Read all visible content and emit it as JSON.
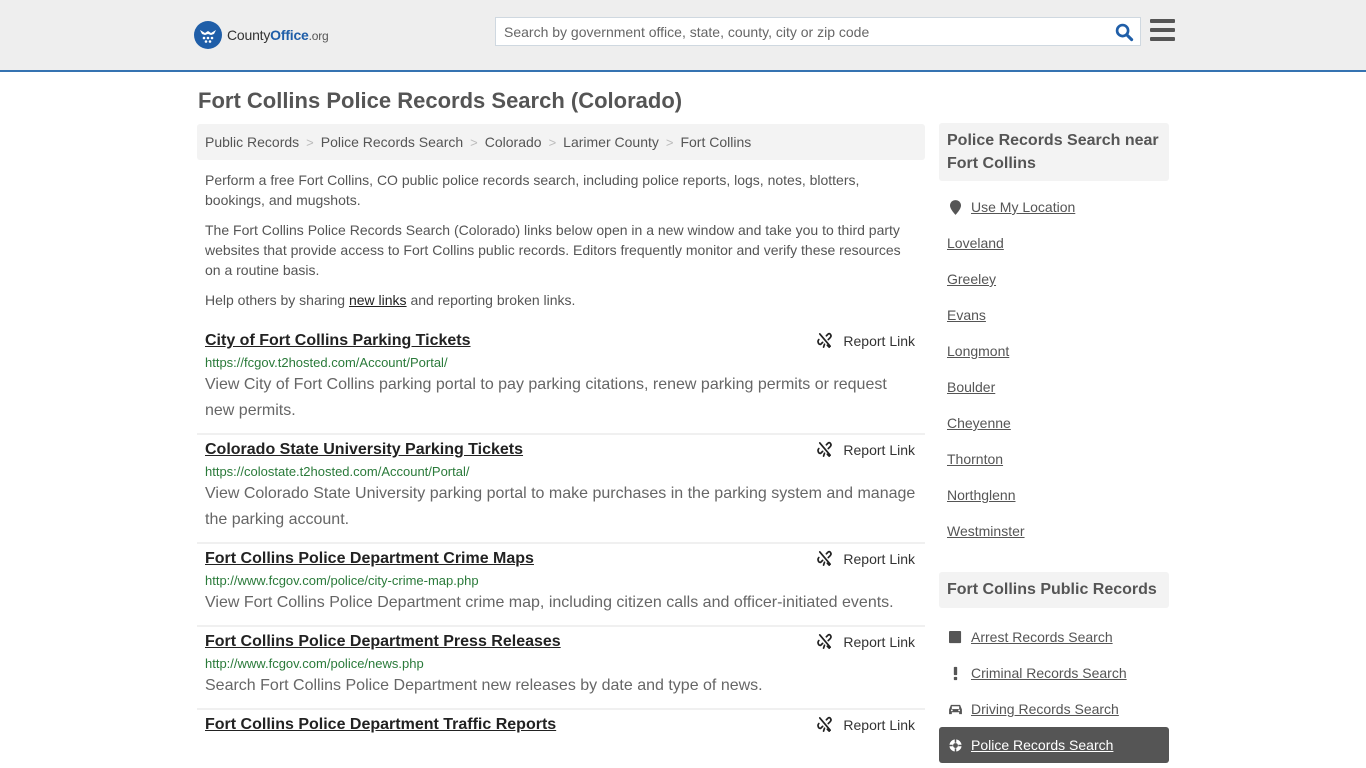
{
  "header": {
    "logo": {
      "brand_county": "County",
      "brand_office": "Office",
      "brand_tld": ".org"
    },
    "search": {
      "placeholder": "Search by government office, state, county, city or zip code",
      "value": ""
    },
    "search_icon": "search-icon",
    "menu_icon": "hamburger-menu-icon"
  },
  "page": {
    "title": "Fort Collins Police Records Search (Colorado)"
  },
  "breadcrumb": [
    {
      "label": "Public Records"
    },
    {
      "label": "Police Records Search"
    },
    {
      "label": "Colorado"
    },
    {
      "label": "Larimer County"
    },
    {
      "label": "Fort Collins"
    }
  ],
  "breadcrumb_separator": ">",
  "intro": {
    "p1": "Perform a free Fort Collins, CO public police records search, including police reports, logs, notes, blotters, bookings, and mugshots.",
    "p2": "The Fort Collins Police Records Search (Colorado) links below open in a new window and take you to third party websites that provide access to Fort Collins public records. Editors frequently monitor and verify these resources on a routine basis.",
    "p3_before": "Help others by sharing ",
    "p3_link": "new links",
    "p3_after": " and reporting broken links."
  },
  "report_label": "Report Link",
  "results": [
    {
      "title": "City of Fort Collins Parking Tickets",
      "url": "https://fcgov.t2hosted.com/Account/Portal/",
      "description": "View City of Fort Collins parking portal to pay parking citations, renew parking permits or request new permits."
    },
    {
      "title": "Colorado State University Parking Tickets",
      "url": "https://colostate.t2hosted.com/Account/Portal/",
      "description": "View Colorado State University parking portal to make purchases in the parking system and manage the parking account."
    },
    {
      "title": "Fort Collins Police Department Crime Maps",
      "url": "http://www.fcgov.com/police/city-crime-map.php",
      "description": "View Fort Collins Police Department crime map, including citizen calls and officer-initiated events."
    },
    {
      "title": "Fort Collins Police Department Press Releases",
      "url": "http://www.fcgov.com/police/news.php",
      "description": "Search Fort Collins Police Department new releases by date and type of news."
    },
    {
      "title": "Fort Collins Police Department Traffic Reports",
      "url": "",
      "description": ""
    }
  ],
  "sidebar": {
    "nearby": {
      "heading": "Police Records Search near Fort Collins",
      "use_location": "Use My Location",
      "cities": [
        "Loveland",
        "Greeley",
        "Evans",
        "Longmont",
        "Boulder",
        "Cheyenne",
        "Thornton",
        "Northglenn",
        "Westminster"
      ]
    },
    "public_records": {
      "heading": "Fort Collins Public Records",
      "items": [
        {
          "label": "Arrest Records Search",
          "icon": "square-icon",
          "active": false
        },
        {
          "label": "Criminal Records Search",
          "icon": "exclamation-icon",
          "active": false
        },
        {
          "label": "Driving Records Search",
          "icon": "car-icon",
          "active": false
        },
        {
          "label": "Police Records Search",
          "icon": "crosshair-icon",
          "active": true
        }
      ]
    }
  },
  "colors": {
    "brand_blue": "#1f5ea8",
    "header_border": "#3573b1",
    "url_green": "#2a7a3a",
    "active_item_bg": "#555555"
  }
}
